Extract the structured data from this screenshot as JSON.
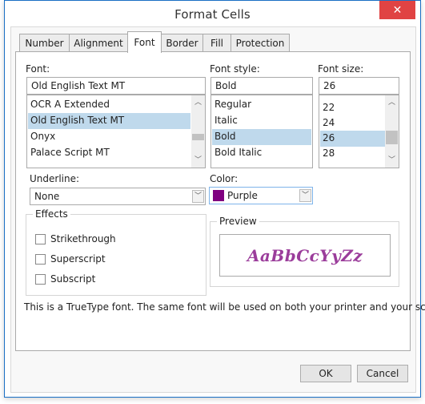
{
  "window": {
    "title": "Format Cells",
    "close_icon": "close-icon"
  },
  "tabs": [
    {
      "label": "Number",
      "active": false
    },
    {
      "label": "Alignment",
      "active": false
    },
    {
      "label": "Font",
      "active": true
    },
    {
      "label": "Border",
      "active": false
    },
    {
      "label": "Fill",
      "active": false
    },
    {
      "label": "Protection",
      "active": false
    }
  ],
  "font": {
    "label": "Font:",
    "value": "Old English Text MT",
    "list": [
      "OCR A Extended",
      "Old English Text MT",
      "Onyx",
      "Palace Script MT"
    ],
    "selected": "Old English Text MT"
  },
  "font_style": {
    "label": "Font style:",
    "value": "Bold",
    "list": [
      "Regular",
      "Italic",
      "Bold",
      "Bold Italic"
    ],
    "selected": "Bold"
  },
  "font_size": {
    "label": "Font size:",
    "value": "26",
    "list": [
      "22",
      "24",
      "26",
      "28"
    ],
    "selected": "26"
  },
  "underline": {
    "label": "Underline:",
    "value": "None"
  },
  "color": {
    "label": "Color:",
    "value": "Purple",
    "swatch": "#800080"
  },
  "effects": {
    "title": "Effects",
    "options": [
      {
        "label": "Strikethrough",
        "checked": false
      },
      {
        "label": "Superscript",
        "checked": false
      },
      {
        "label": "Subscript",
        "checked": false
      }
    ]
  },
  "preview": {
    "title": "Preview",
    "sample": "AaBbCcYyZz",
    "color": "#9b3d9b"
  },
  "note": "This is a TrueType font. The same font will be used on both your printer and your screen.",
  "buttons": {
    "ok": "OK",
    "cancel": "Cancel"
  }
}
